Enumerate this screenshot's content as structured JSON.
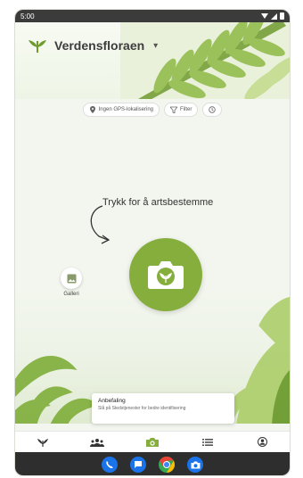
{
  "status_bar": {
    "time": "5:00"
  },
  "app": {
    "brand_name": "Verdensfloraen",
    "brand_chevron": "▾"
  },
  "chips": [
    {
      "label": "Ingen GPS-lokalisering",
      "icon": "location-pin-icon"
    },
    {
      "label": "Filter",
      "icon": "filter-icon"
    },
    {
      "label": "",
      "icon": "info-icon"
    }
  ],
  "main": {
    "hint": "Trykk for å artsbestemme",
    "gallery_label": "Galleri"
  },
  "recommendation": {
    "title": "Anbefaling",
    "text": "Slå på Stedstjenester for bedre identifisering"
  },
  "bottom_nav": [
    {
      "name": "home",
      "icon": "plant-icon"
    },
    {
      "name": "community",
      "icon": "people-icon"
    },
    {
      "name": "identify",
      "icon": "camera-icon",
      "active": true
    },
    {
      "name": "list",
      "icon": "list-icon"
    },
    {
      "name": "profile",
      "icon": "profile-icon"
    }
  ],
  "dock_apps": [
    "phone-icon",
    "messages-icon",
    "chrome-icon",
    "camera-app-icon"
  ],
  "colors": {
    "accent": "#86ae3d",
    "dark": "#2e2e2e"
  }
}
